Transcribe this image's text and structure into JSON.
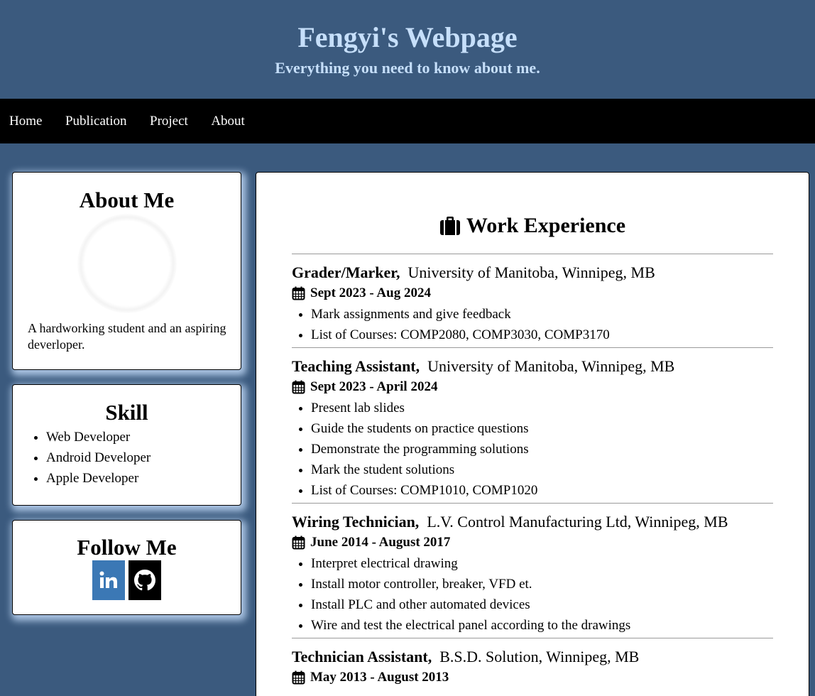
{
  "header": {
    "title": "Fengyi's Webpage",
    "subtitle": "Everything you need to know about me."
  },
  "nav": [
    "Home",
    "Publication",
    "Project",
    "About"
  ],
  "about": {
    "heading": "About Me",
    "text": "A hardworking student and an aspiring deverloper."
  },
  "skill": {
    "heading": "Skill",
    "items": [
      "Web Developer",
      "Android Developer",
      "Apple Developer"
    ]
  },
  "follow": {
    "heading": "Follow Me",
    "icons": [
      "linkedin-icon",
      "github-icon"
    ]
  },
  "work": {
    "heading": "Work Experience",
    "icon": "briefcase-icon",
    "jobs": [
      {
        "role": "Grader/Marker,",
        "org": "University of Manitoba, Winnipeg, MB",
        "dates": "Sept 2023 - Aug 2024",
        "tasks": [
          "Mark assignments and give feedback",
          "List of Courses: COMP2080, COMP3030, COMP3170"
        ]
      },
      {
        "role": "Teaching Assistant,",
        "org": "University of Manitoba, Winnipeg, MB",
        "dates": "Sept 2023 - April 2024",
        "tasks": [
          "Present lab slides",
          "Guide the students on practice questions",
          "Demonstrate the programming solutions",
          "Mark the student solutions",
          "List of Courses: COMP1010, COMP1020"
        ]
      },
      {
        "role": "Wiring Technician,",
        "org": "L.V. Control Manufacturing Ltd, Winnipeg, MB",
        "dates": "June 2014 - August 2017",
        "tasks": [
          "Interpret electrical drawing",
          "Install motor controller, breaker, VFD et.",
          "Install PLC and other automated devices",
          "Wire and test the electrical panel according to the drawings"
        ]
      },
      {
        "role": "Technician Assistant,",
        "org": "B.S.D. Solution, Winnipeg, MB",
        "dates": "May 2013 - August 2013",
        "tasks": []
      }
    ]
  },
  "colors": {
    "background": "#3b5a7e",
    "header_text": "#c6dffa",
    "nav_bg": "#000000",
    "linkedin": "#3b78b5"
  }
}
